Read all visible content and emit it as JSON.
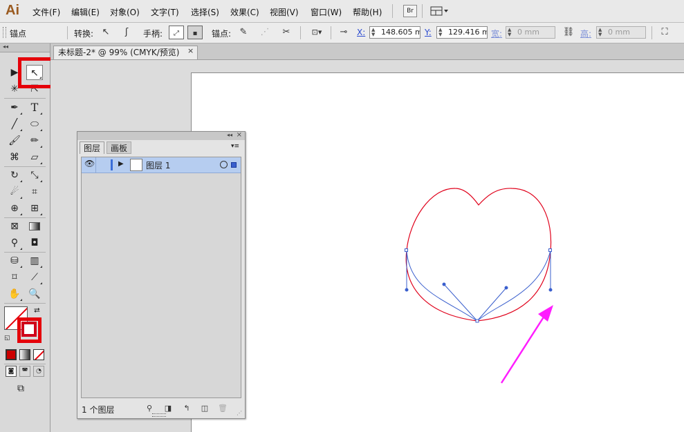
{
  "app": {
    "logo": "Ai",
    "accent_color": "#9a5a20"
  },
  "menu": {
    "items": [
      "文件(F)",
      "编辑(E)",
      "对象(O)",
      "文字(T)",
      "选择(S)",
      "效果(C)",
      "视图(V)",
      "窗口(W)",
      "帮助(H)"
    ],
    "bridge_label": "Br"
  },
  "control_bar": {
    "selection_label": "锚点",
    "convert_label": "转换:",
    "handles_label": "手柄:",
    "anchors_label": "锚点:",
    "x_label": "X:",
    "x_value": "148.605 m",
    "y_label": "Y:",
    "y_value": "129.416 m",
    "w_label": "宽:",
    "w_value": "0 mm",
    "h_label": "高:",
    "h_value": "0 mm"
  },
  "document": {
    "tab_title": "未标题-2* @ 99% (CMYK/预览)",
    "close_glyph": "×"
  },
  "layers_panel": {
    "tabs": [
      "图层",
      "画板"
    ],
    "active_tab": "图层",
    "layer_name": "图层 1",
    "footer_count": "1 个图层",
    "row_color": "#b6cdf0"
  },
  "canvas": {
    "path_color": "#e0001a",
    "selection_color": "#3a5fcd",
    "arrow_color": "#ff1dff"
  },
  "highlight_color": "#e5000a"
}
